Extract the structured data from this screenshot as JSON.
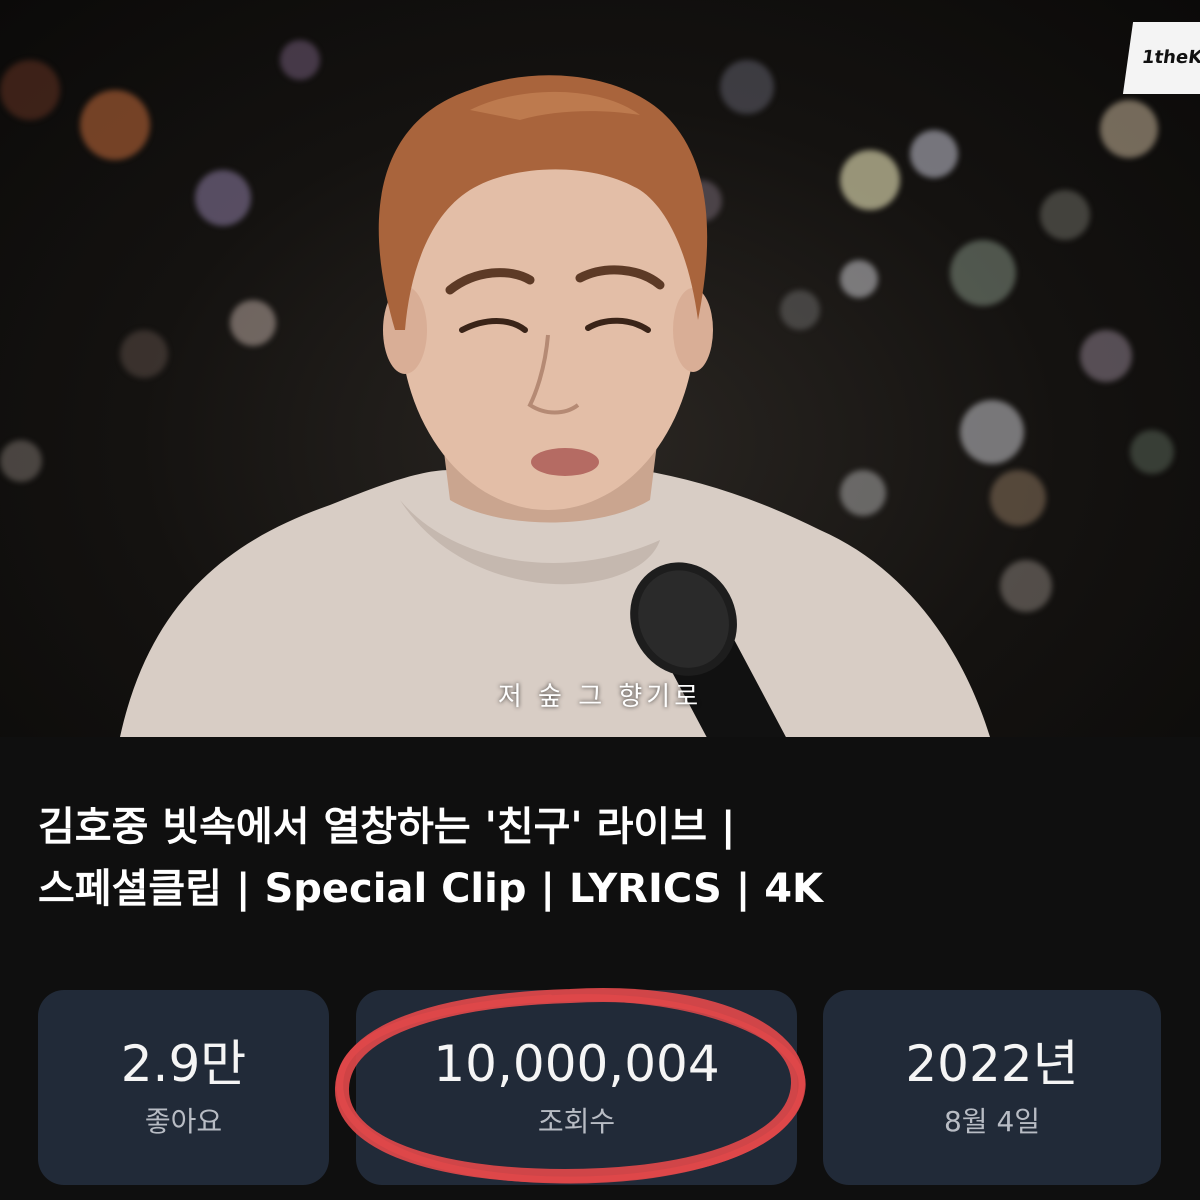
{
  "video": {
    "channel_logo": "1theK",
    "subtitle": "저 숲 그 향기로"
  },
  "title": {
    "line1": "김호중 빗속에서 열창하는 '친구' 라이브 |",
    "line2": " 스페셜클립 | Special Clip | LYRICS | 4K"
  },
  "stats": {
    "likes": {
      "value": "2.9만",
      "label": "좋아요"
    },
    "views": {
      "value": "10,000,004",
      "label": "조회수"
    },
    "date": {
      "value": "2022년",
      "label": "8월 4일"
    }
  },
  "colors": {
    "background": "#0f0f0f",
    "card": "#212a38",
    "highlight": "#e0484a",
    "label": "#b8bcc4"
  }
}
